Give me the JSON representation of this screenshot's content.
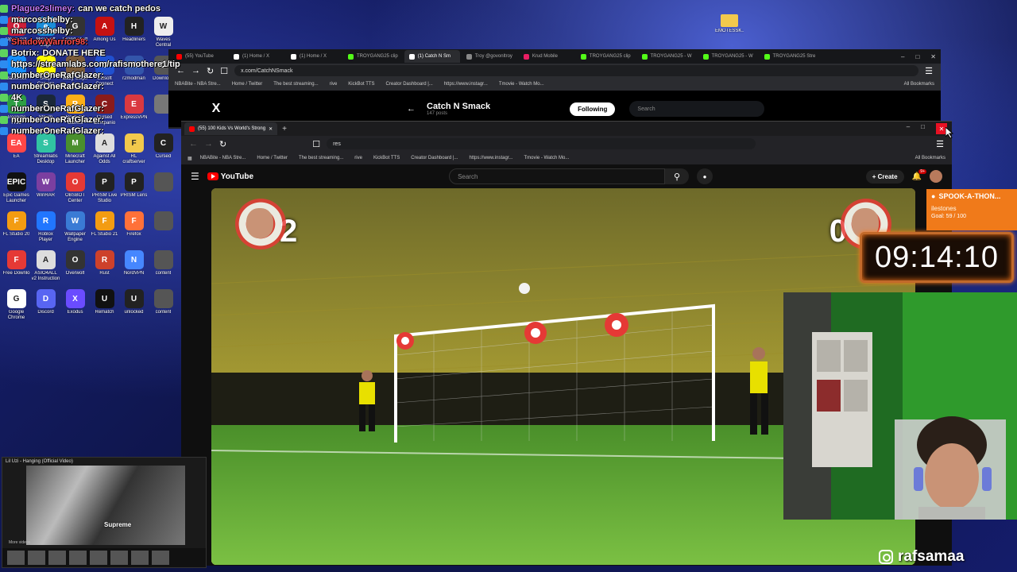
{
  "chat": [
    {
      "user": "Plague2slimey:",
      "message": "can we catch pedos",
      "color": "#c77dff"
    },
    {
      "user": "marcosshelby:",
      "message": "",
      "color": "#ffffff"
    },
    {
      "user": "marcosshelby:",
      "message": "",
      "color": "#ffffff"
    },
    {
      "user": "ShadowWarrior98:",
      "message": "",
      "color": "#ff4d4d"
    },
    {
      "user": "Botrix:",
      "message": "DONATE HERE",
      "color": "#ffffff"
    },
    {
      "user": "https://streamlabs.com/rafismothere1/tip",
      "message": "",
      "color": "#ffffff"
    },
    {
      "user": "numberOneRafGlazer:",
      "message": "",
      "color": "#ffffff"
    },
    {
      "user": "numberOneRafGlazer:",
      "message": "",
      "color": "#ffffff"
    },
    {
      "user": "4K",
      "message": "",
      "color": "#ffffff"
    },
    {
      "user": "numberOneRafGlazer:",
      "message": "",
      "color": "#ffffff"
    },
    {
      "user": "numberOneRafGlazer:",
      "message": "",
      "color": "#ffffff"
    },
    {
      "user": "numberOneRafGlazer:",
      "message": "",
      "color": "#ffffff"
    }
  ],
  "desktop_icons": [
    {
      "label": "Opera GX",
      "color": "#cc1f3a",
      "glyph": "O"
    },
    {
      "label": "Microsoft Edge",
      "color": "#1a8cd8",
      "glyph": "e"
    },
    {
      "label": "Grand Theft",
      "color": "#333333",
      "glyph": "G"
    },
    {
      "label": "Among Us",
      "color": "#c51111",
      "glyph": "A"
    },
    {
      "label": "Headliners",
      "color": "#222222",
      "glyph": "H"
    },
    {
      "label": "Waves Central",
      "color": "#eeeeee",
      "glyph": "W"
    },
    {
      "label": "Battle.net",
      "color": "#148eff",
      "glyph": "B"
    },
    {
      "label": "Snap Camera",
      "color": "#fffc00",
      "glyph": "S"
    },
    {
      "label": "Baby Steps",
      "color": "#7a5b3a",
      "glyph": "b"
    },
    {
      "label": "Ubisoft Connect",
      "color": "#2050d0",
      "glyph": "U"
    },
    {
      "label": "r2modman",
      "color": "#3355aa",
      "glyph": "R"
    },
    {
      "label": "Download",
      "color": "#555555",
      "glyph": "D"
    },
    {
      "label": "TreeSize Free",
      "color": "#2e9e44",
      "glyph": "T"
    },
    {
      "label": "Steam",
      "color": "#1b2838",
      "glyph": "S"
    },
    {
      "label": "Rockstar Games",
      "color": "#fcaf17",
      "glyph": "R"
    },
    {
      "label": "Cursed Companio",
      "color": "#8a1b1b",
      "glyph": "C"
    },
    {
      "label": "ExpressVPN",
      "color": "#da3940",
      "glyph": "E"
    },
    {
      "label": "",
      "color": "#777777",
      "glyph": ""
    },
    {
      "label": "EA",
      "color": "#ff4747",
      "glyph": "EA"
    },
    {
      "label": "Streamlabs Desktop",
      "color": "#31c3a2",
      "glyph": "S"
    },
    {
      "label": "Minecraft Launcher",
      "color": "#4a8f2d",
      "glyph": "M"
    },
    {
      "label": "Against All Odds",
      "color": "#dddddd",
      "glyph": "A"
    },
    {
      "label": "RL craftserver",
      "color": "#f2c94c",
      "glyph": "F"
    },
    {
      "label": "Cursed",
      "color": "#222222",
      "glyph": "C"
    },
    {
      "label": "Epic Games Launcher",
      "color": "#111111",
      "glyph": "EPIC"
    },
    {
      "label": "WinRAR",
      "color": "#7b3fa0",
      "glyph": "W"
    },
    {
      "label": "OBSBOT Center",
      "color": "#e53935",
      "glyph": "O"
    },
    {
      "label": "PRISM Live Studio",
      "color": "#222222",
      "glyph": "P"
    },
    {
      "label": "PRISM Lens",
      "color": "#222222",
      "glyph": "P"
    },
    {
      "label": "",
      "color": "#555555",
      "glyph": ""
    },
    {
      "label": "FL Studio 20",
      "color": "#f39c12",
      "glyph": "F"
    },
    {
      "label": "Roblox Player",
      "color": "#2176ff",
      "glyph": "R"
    },
    {
      "label": "Wallpaper Engine",
      "color": "#3a7bd5",
      "glyph": "W"
    },
    {
      "label": "FL Studio 21",
      "color": "#f39c12",
      "glyph": "F"
    },
    {
      "label": "Firefox",
      "color": "#ff7139",
      "glyph": "F"
    },
    {
      "label": "",
      "color": "#555555",
      "glyph": ""
    },
    {
      "label": "Free Downlo",
      "color": "#e53935",
      "glyph": "F"
    },
    {
      "label": "ASIO4ALL v2 Instruction",
      "color": "#dddddd",
      "glyph": "A"
    },
    {
      "label": "Overwolf",
      "color": "#333333",
      "glyph": "O"
    },
    {
      "label": "Rust",
      "color": "#cd412b",
      "glyph": "R"
    },
    {
      "label": "NordVPN",
      "color": "#4687ff",
      "glyph": "N"
    },
    {
      "label": "content",
      "color": "#555555",
      "glyph": ""
    },
    {
      "label": "Google Chrome",
      "color": "#ffffff",
      "glyph": "G"
    },
    {
      "label": "Discord",
      "color": "#5865f2",
      "glyph": "D"
    },
    {
      "label": "Exodus",
      "color": "#6a4cff",
      "glyph": "X"
    },
    {
      "label": "Rematch",
      "color": "#111111",
      "glyph": "U"
    },
    {
      "label": "unlocked",
      "color": "#222222",
      "glyph": "U"
    },
    {
      "label": "content",
      "color": "#555555",
      "glyph": ""
    }
  ],
  "emotes_folder": {
    "label": "EMOTESSK..."
  },
  "back_browser": {
    "tabs": [
      {
        "label": "(55) YouTube",
        "color": "#ff0000"
      },
      {
        "label": "(1) Home / X",
        "color": "#ffffff"
      },
      {
        "label": "(1) Home / X",
        "color": "#ffffff"
      },
      {
        "label": "TROYGANG25 clip",
        "color": "#53fc18"
      },
      {
        "label": "(1) Catch N Sm",
        "color": "#ffffff",
        "active": true
      },
      {
        "label": "Troy @govonltroy",
        "color": "#888888"
      },
      {
        "label": "Krud Mobile",
        "color": "#e91e63"
      },
      {
        "label": "TROYGANG25 clip",
        "color": "#53fc18"
      },
      {
        "label": "TROYGANG25 - W",
        "color": "#53fc18"
      },
      {
        "label": "TROYGANG25 - W",
        "color": "#53fc18"
      },
      {
        "label": "TROYGANG25 Stre",
        "color": "#53fc18"
      }
    ],
    "url": "x.com/CatchNSmack",
    "bookmarks": [
      "NBABite - NBA Stre...",
      "Home / Twitter",
      "The best streaming...",
      "rive",
      "KickBot TTS",
      "Creator Dashboard |...",
      "https://www.instagr...",
      "Tmovie - Watch Mo..."
    ],
    "all_bookmarks": "All Bookmarks",
    "x_logo": "X",
    "profile_name": "Catch N Smack",
    "profile_posts": "147 posts",
    "following_label": "Following",
    "search_placeholder": "Search"
  },
  "front_browser": {
    "tab_label": "(55) 100 Kids Vs World's Strong",
    "url": "res",
    "bookmarks": [
      "NBABite - NBA Stre...",
      "Home / Twitter",
      "The best streaming...",
      "rive",
      "KickBot TTS",
      "Creator Dashboard |...",
      "https://www.instagr...",
      "Tmovie - Watch Mo..."
    ],
    "all_bookmarks": "All Bookmarks",
    "yt_logo": "YouTube",
    "search_placeholder": "Search",
    "create_label": "Create",
    "notification_count": "9+"
  },
  "video": {
    "score_left": "2",
    "score_right": "0"
  },
  "music_thumb": {
    "title": "Lil Uzi - Hanging (Official Video)",
    "brand": "Supreme",
    "more": "More videos"
  },
  "spook": {
    "title": "SPOOK-A-THON...",
    "subtitle": "ilestones",
    "goal": "Goal: 59 / 100"
  },
  "timer": "09:14:10",
  "instagram": {
    "handle": "rafsamaa"
  },
  "colors": {
    "accent_youtube": "#ff0000",
    "close_red": "#e81123",
    "timer_border": "#c26a2a",
    "spook_orange": "#f07a1a"
  }
}
